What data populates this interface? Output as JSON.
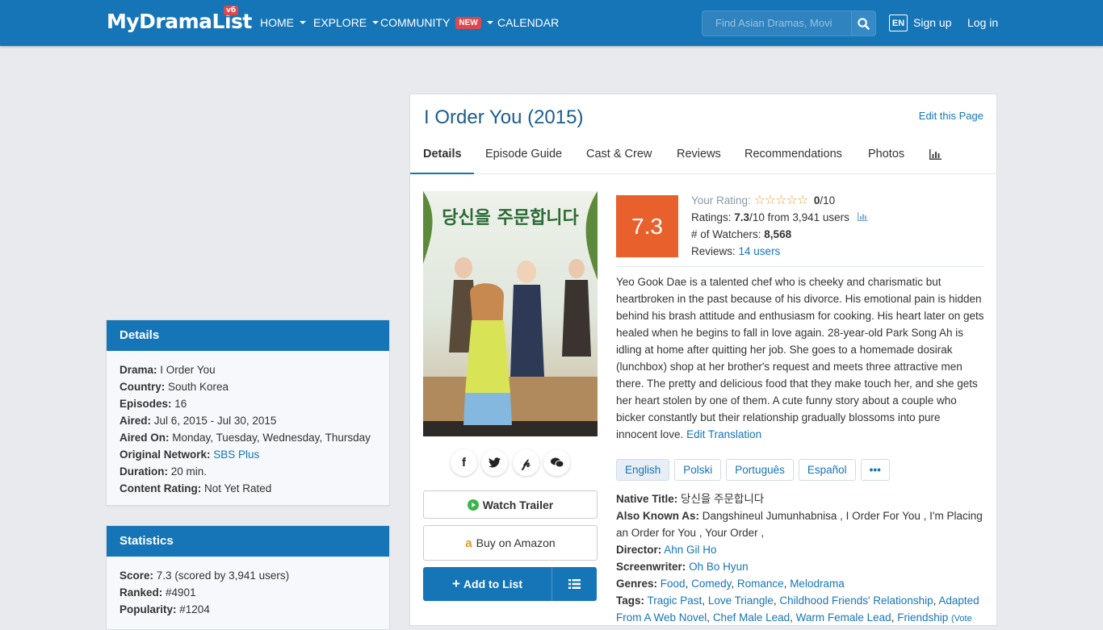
{
  "nav": {
    "logo": "MyDramaList",
    "logo_badge": "vб",
    "items": [
      {
        "label": "HOME",
        "caret": true
      },
      {
        "label": "EXPLORE",
        "caret": true
      },
      {
        "label": "COMMUNITY",
        "caret": true,
        "badge": "NEW"
      },
      {
        "label": "CALENDAR",
        "caret": false
      }
    ],
    "search_placeholder": "Find Asian Dramas, Movi",
    "lang": "EN",
    "sign_up": "Sign up",
    "log_in": "Log in"
  },
  "details_box": {
    "title": "Details",
    "rows": [
      {
        "label": "Drama:",
        "value": "I Order You"
      },
      {
        "label": "Country:",
        "value": "South Korea"
      },
      {
        "label": "Episodes:",
        "value": "16"
      },
      {
        "label": "Aired:",
        "value": "Jul 6, 2015 - Jul 30, 2015"
      },
      {
        "label": "Aired On:",
        "value": "Monday, Tuesday, Wednesday, Thursday"
      },
      {
        "label": "Original Network:",
        "value": "SBS Plus",
        "link": true
      },
      {
        "label": "Duration:",
        "value": "20 min."
      },
      {
        "label": "Content Rating:",
        "value": "Not Yet Rated"
      }
    ]
  },
  "statistics_box": {
    "title": "Statistics",
    "rows": [
      {
        "label": "Score:",
        "value": "7.3 (scored by 3,941 users)"
      },
      {
        "label": "Ranked:",
        "value": "#4901"
      },
      {
        "label": "Popularity:",
        "value": "#1204"
      }
    ]
  },
  "main": {
    "title": "I Order You (2015)",
    "edit_page": "Edit this Page",
    "tabs": [
      "Details",
      "Episode Guide",
      "Cast & Crew",
      "Reviews",
      "Recommendations",
      "Photos"
    ],
    "score": "7.3",
    "your_rating_label": "Your Rating:",
    "your_rating_value": "0",
    "your_rating_max": "/10",
    "ratings_label": "Ratings:",
    "ratings_value": "7.3",
    "ratings_rest": "/10 from 3,941 users",
    "watchers_label": "# of Watchers:",
    "watchers_value": "8,568",
    "reviews_label": "Reviews:",
    "reviews_value": "14 users",
    "synopsis": "Yeo Gook Dae is a talented chef who is cheeky and charismatic but heartbroken in the past because of his divorce. His emotional pain is hidden behind his brash attitude and enthusiasm for cooking. His heart later on gets healed when he begins to fall in love again. 28-year-old Park Song Ah is idling at home after quitting her job. She goes to a homemade dosirak (lunchbox) shop at her brother's request and meets three attractive men there. The pretty and delicious food that they make touch her, and she gets her heart stolen by one of them. A cute funny story about a couple who bicker constantly but their relationship gradually blossoms into pure innocent love.",
    "edit_translation": "Edit Translation",
    "languages": [
      "English",
      "Polski",
      "Português",
      "Español",
      "•••"
    ],
    "watch_trailer": "Watch Trailer",
    "buy_amazon": "Buy on Amazon",
    "add_to_list": "Add to List",
    "poster_title": "당신을 주문합니다",
    "info": {
      "native_title_label": "Native Title:",
      "native_title": "당신을 주문합니다",
      "aka_label": "Also Known As:",
      "aka": "Dangshineul Jumunhabnisa , I Order For You , I'm Placing an Order for You , Your Order ,",
      "director_label": "Director:",
      "director": "Ahn Gil Ho",
      "screenwriter_label": "Screenwriter:",
      "screenwriter": "Oh Bo Hyun",
      "genres_label": "Genres:",
      "genres": [
        "Food",
        "Comedy",
        "Romance",
        "Melodrama"
      ],
      "tags_label": "Tags:",
      "tags": [
        "Tragic Past",
        "Love Triangle",
        "Childhood Friends' Relationship",
        "Adapted From A Web Novel",
        "Chef Male Lead",
        "Warm Female Lead",
        "Friendship"
      ],
      "tags_more": "(Vote"
    }
  }
}
